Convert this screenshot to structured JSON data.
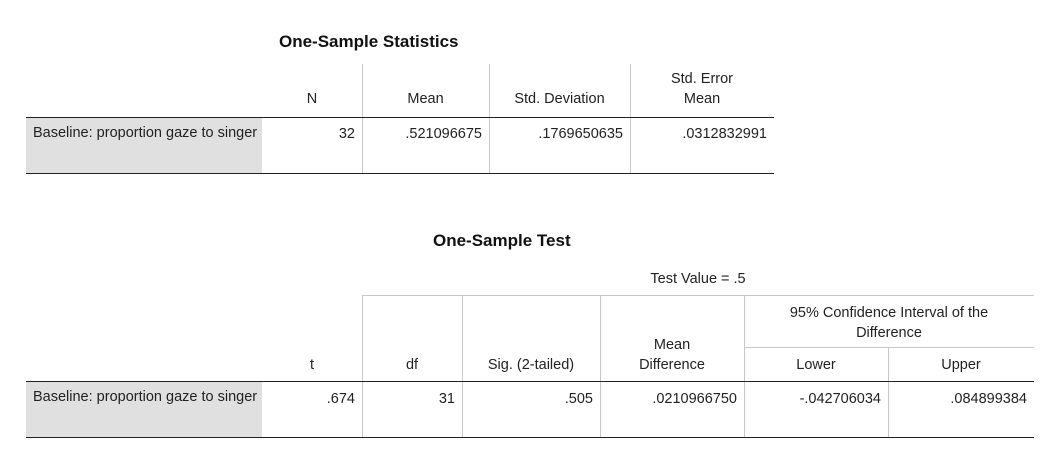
{
  "stats_table": {
    "title": "One-Sample Statistics",
    "headers": {
      "n": "N",
      "mean": "Mean",
      "std_dev": "Std. Deviation",
      "se_mean_line1": "Std. Error",
      "se_mean_line2": "Mean"
    },
    "row": {
      "label": "Baseline: proportion gaze to singer",
      "n": "32",
      "mean": ".521096675",
      "std_dev": ".1769650635",
      "se_mean": ".0312832991"
    }
  },
  "test_table": {
    "title": "One-Sample Test",
    "test_value": "Test Value = .5",
    "headers": {
      "t": "t",
      "df": "df",
      "sig": "Sig. (2-tailed)",
      "mean_diff_line1": "Mean",
      "mean_diff_line2": "Difference",
      "ci": "95% Confidence Interval of the Difference",
      "lower": "Lower",
      "upper": "Upper"
    },
    "row": {
      "label": "Baseline: proportion gaze to singer",
      "t": ".674",
      "df": "31",
      "sig": ".505",
      "mean_diff": ".0210966750",
      "lower": "-.042706034",
      "upper": ".084899384"
    }
  }
}
